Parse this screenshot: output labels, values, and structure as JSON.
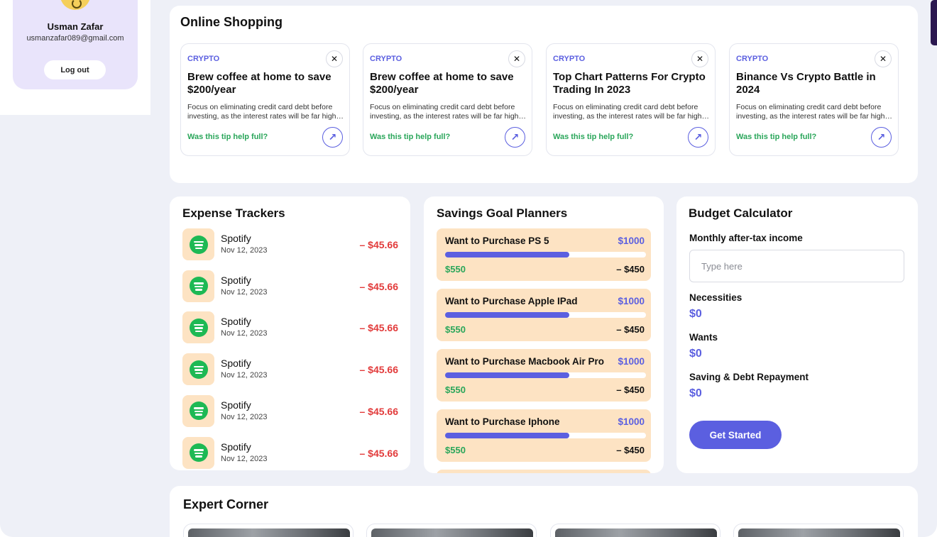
{
  "profile": {
    "name": "Usman Zafar",
    "email": "usmanzafar089@gmail.com",
    "logout_label": "Log out"
  },
  "online_shopping": {
    "title": "Online Shopping",
    "cards": [
      {
        "tag": "CRYPTO",
        "title": "Brew coffee at home to save $200/year",
        "desc": "Focus on eliminating credit card debt before investing, as the interest rates will be far higher than returns.",
        "help": "Was this tip help full?"
      },
      {
        "tag": "CRYPTO",
        "title": "Brew coffee at home to save $200/year",
        "desc": "Focus on eliminating credit card debt before investing, as the interest rates will be far higher than returns.",
        "help": "Was this tip help full?"
      },
      {
        "tag": "CRYPTO",
        "title": "Top Chart Patterns For Crypto Trading In 2023",
        "desc": "Focus on eliminating credit card debt before investing, as the interest rates will be far higher than returns.",
        "help": "Was this tip help full?"
      },
      {
        "tag": "CRYPTO",
        "title": "Binance Vs Crypto Battle in 2024",
        "desc": "Focus on eliminating credit card debt before investing, as the interest rates will be far higher than returns.",
        "help": "Was this tip help full?"
      }
    ],
    "close_glyph": "✕",
    "arrow_glyph": "↗"
  },
  "expenses": {
    "title": "Expense Trackers",
    "icon": "spotify-icon",
    "items": [
      {
        "name": "Spotify",
        "date": "Nov 12, 2023",
        "amount": "– $45.66"
      },
      {
        "name": "Spotify",
        "date": "Nov 12, 2023",
        "amount": "– $45.66"
      },
      {
        "name": "Spotify",
        "date": "Nov 12, 2023",
        "amount": "– $45.66"
      },
      {
        "name": "Spotify",
        "date": "Nov 12, 2023",
        "amount": "– $45.66"
      },
      {
        "name": "Spotify",
        "date": "Nov 12, 2023",
        "amount": "– $45.66"
      },
      {
        "name": "Spotify",
        "date": "Nov 12, 2023",
        "amount": "– $45.66"
      }
    ]
  },
  "savings": {
    "title": "Savings Goal Planners",
    "goals": [
      {
        "title": "Want to Purchase PS 5",
        "target": "$1000",
        "saved": "$550",
        "remaining": "– $450",
        "progress": 0.62
      },
      {
        "title": "Want to Purchase Apple IPad",
        "target": "$1000",
        "saved": "$550",
        "remaining": "– $450",
        "progress": 0.62
      },
      {
        "title": "Want to Purchase Macbook Air Pro",
        "target": "$1000",
        "saved": "$550",
        "remaining": "– $450",
        "progress": 0.62
      },
      {
        "title": "Want to Purchase Iphone",
        "target": "$1000",
        "saved": "$550",
        "remaining": "– $450",
        "progress": 0.62
      }
    ]
  },
  "budget": {
    "title": "Budget Calculator",
    "income_label": "Monthly after-tax income",
    "income_placeholder": "Type here",
    "income_value": "",
    "necessities_label": "Necessities",
    "necessities_value": "$0",
    "wants_label": "Wants",
    "wants_value": "$0",
    "saving_label": "Saving & Debt Repayment",
    "saving_value": "$0",
    "cta": "Get Started"
  },
  "expert": {
    "title": "Expert Corner",
    "card_count": 4
  },
  "colors": {
    "accent": "#5b5fe0",
    "positive": "#2aa65a",
    "negative": "#e23b3b",
    "goal_bg": "#fde3c3",
    "profile_bg": "#e9e4fb"
  }
}
